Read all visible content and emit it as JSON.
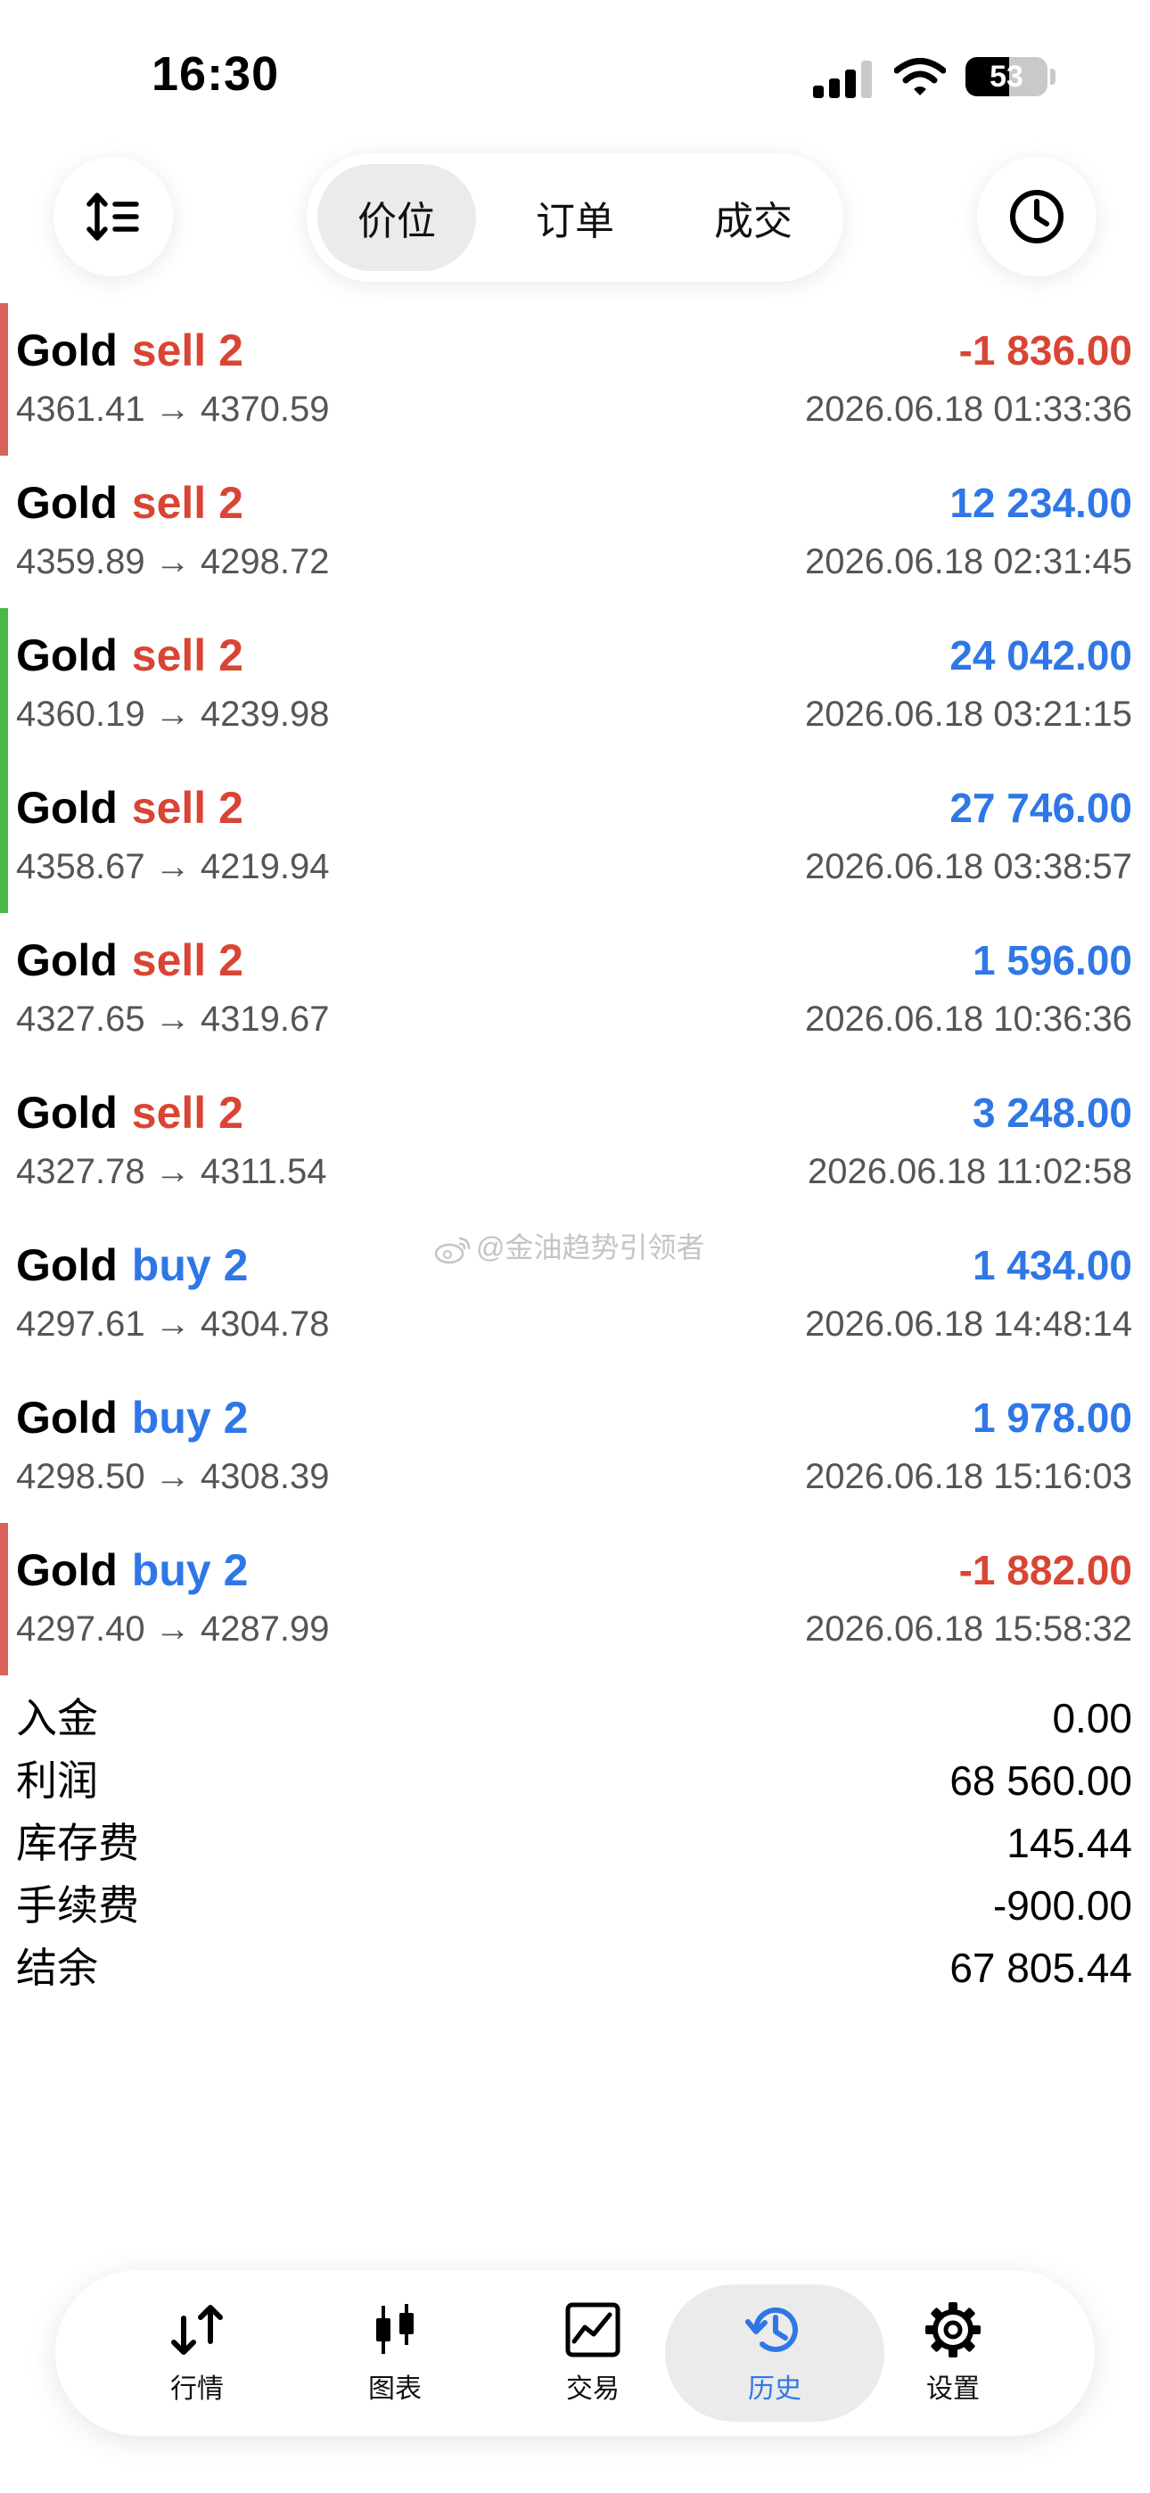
{
  "status_bar": {
    "time": "16:30",
    "battery": "53",
    "battery_level": 0.53
  },
  "segments": [
    {
      "label": "价位",
      "active": true
    },
    {
      "label": "订单",
      "active": false
    },
    {
      "label": "成交",
      "active": false
    }
  ],
  "deals": [
    {
      "symbol": "Gold",
      "side": "sell 2",
      "side_color": "#d94534",
      "open": "4361.41",
      "close": "4370.59",
      "profit": "-1 836.00",
      "profit_color": "#d94534",
      "time": "2026.06.18 01:33:36",
      "bar_color": "#d9635a"
    },
    {
      "symbol": "Gold",
      "side": "sell 2",
      "side_color": "#d94534",
      "open": "4359.89",
      "close": "4298.72",
      "profit": "12 234.00",
      "profit_color": "#2f77e6",
      "time": "2026.06.18 02:31:45",
      "bar_color": ""
    },
    {
      "symbol": "Gold",
      "side": "sell 2",
      "side_color": "#d94534",
      "open": "4360.19",
      "close": "4239.98",
      "profit": "24 042.00",
      "profit_color": "#2f77e6",
      "time": "2026.06.18 03:21:15",
      "bar_color": "#4cb84a"
    },
    {
      "symbol": "Gold",
      "side": "sell 2",
      "side_color": "#d94534",
      "open": "4358.67",
      "close": "4219.94",
      "profit": "27 746.00",
      "profit_color": "#2f77e6",
      "time": "2026.06.18 03:38:57",
      "bar_color": "#4cb84a"
    },
    {
      "symbol": "Gold",
      "side": "sell 2",
      "side_color": "#d94534",
      "open": "4327.65",
      "close": "4319.67",
      "profit": "1 596.00",
      "profit_color": "#2f77e6",
      "time": "2026.06.18 10:36:36",
      "bar_color": ""
    },
    {
      "symbol": "Gold",
      "side": "sell 2",
      "side_color": "#d94534",
      "open": "4327.78",
      "close": "4311.54",
      "profit": "3 248.00",
      "profit_color": "#2f77e6",
      "time": "2026.06.18 11:02:58",
      "bar_color": ""
    },
    {
      "symbol": "Gold",
      "side": "buy 2",
      "side_color": "#2f77e6",
      "open": "4297.61",
      "close": "4304.78",
      "profit": "1 434.00",
      "profit_color": "#2f77e6",
      "time": "2026.06.18 14:48:14",
      "bar_color": ""
    },
    {
      "symbol": "Gold",
      "side": "buy 2",
      "side_color": "#2f77e6",
      "open": "4298.50",
      "close": "4308.39",
      "profit": "1 978.00",
      "profit_color": "#2f77e6",
      "time": "2026.06.18 15:16:03",
      "bar_color": ""
    },
    {
      "symbol": "Gold",
      "side": "buy 2",
      "side_color": "#2f77e6",
      "open": "4297.40",
      "close": "4287.99",
      "profit": "-1 882.00",
      "profit_color": "#d94534",
      "time": "2026.06.18 15:58:32",
      "bar_color": "#d9635a"
    }
  ],
  "arrow": "→",
  "summary": [
    {
      "label": "入金",
      "value": "0.00"
    },
    {
      "label": "利润",
      "value": "68 560.00"
    },
    {
      "label": "库存费",
      "value": "145.44"
    },
    {
      "label": "手续费",
      "value": "-900.00"
    },
    {
      "label": "结余",
      "value": "67 805.44"
    }
  ],
  "watermark": "@金油趋势引领者",
  "tabs": [
    {
      "label": "行情",
      "icon": "quotes-icon",
      "active": false
    },
    {
      "label": "图表",
      "icon": "candlestick-chart-icon",
      "active": false
    },
    {
      "label": "交易",
      "icon": "trade-chart-icon",
      "active": false
    },
    {
      "label": "历史",
      "icon": "history-icon",
      "active": true
    },
    {
      "label": "设置",
      "icon": "gear-icon",
      "active": false
    }
  ],
  "colors": {
    "sell": "#d94534",
    "buy": "#2f77e6",
    "accent": "#2f77e6",
    "active_bg": "#ebebeb"
  }
}
